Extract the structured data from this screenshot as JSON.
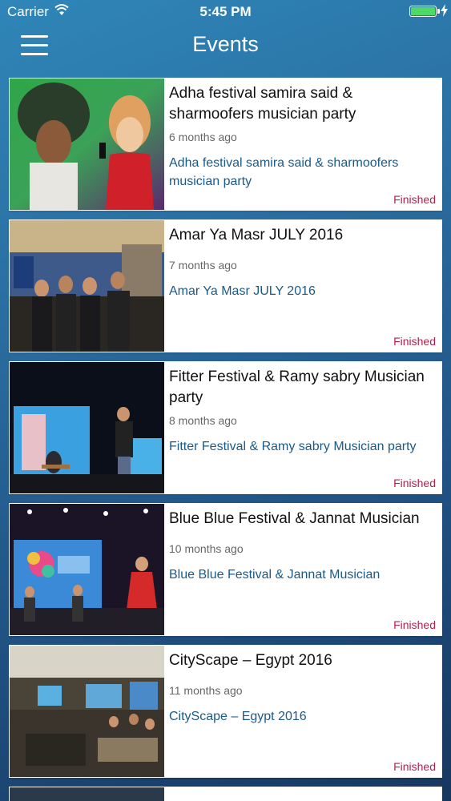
{
  "status_bar": {
    "carrier": "Carrier",
    "time": "5:45 PM",
    "battery_level": 1.0
  },
  "nav": {
    "title": "Events",
    "menu_icon": "hamburger-menu-icon"
  },
  "events": [
    {
      "title": "Adha festival samira said & sharmoofers musician party",
      "time_ago": "6 months ago",
      "description": "Adha festival samira said & sharmoofers musician party",
      "status": "Finished"
    },
    {
      "title": "Amar Ya Masr JULY 2016",
      "time_ago": "7 months ago",
      "description": "Amar Ya Masr JULY 2016",
      "status": "Finished"
    },
    {
      "title": "Fitter Festival & Ramy sabry Musician party",
      "time_ago": "8 months ago",
      "description": "Fitter Festival & Ramy sabry Musician party",
      "status": "Finished"
    },
    {
      "title": "Blue Blue Festival & Jannat Musician",
      "time_ago": "10 months ago",
      "description": "Blue Blue Festival & Jannat Musician",
      "status": "Finished"
    },
    {
      "title": "CityScape – Egypt 2016",
      "time_ago": "11 months ago",
      "description": "CityScape – Egypt 2016",
      "status": "Finished"
    }
  ],
  "colors": {
    "header_gradient_start": "#2f86b8",
    "header_gradient_end": "#17375f",
    "description_text": "#1a5a8a",
    "status_finished": "#b3204d",
    "battery_fill": "#4cd964"
  }
}
